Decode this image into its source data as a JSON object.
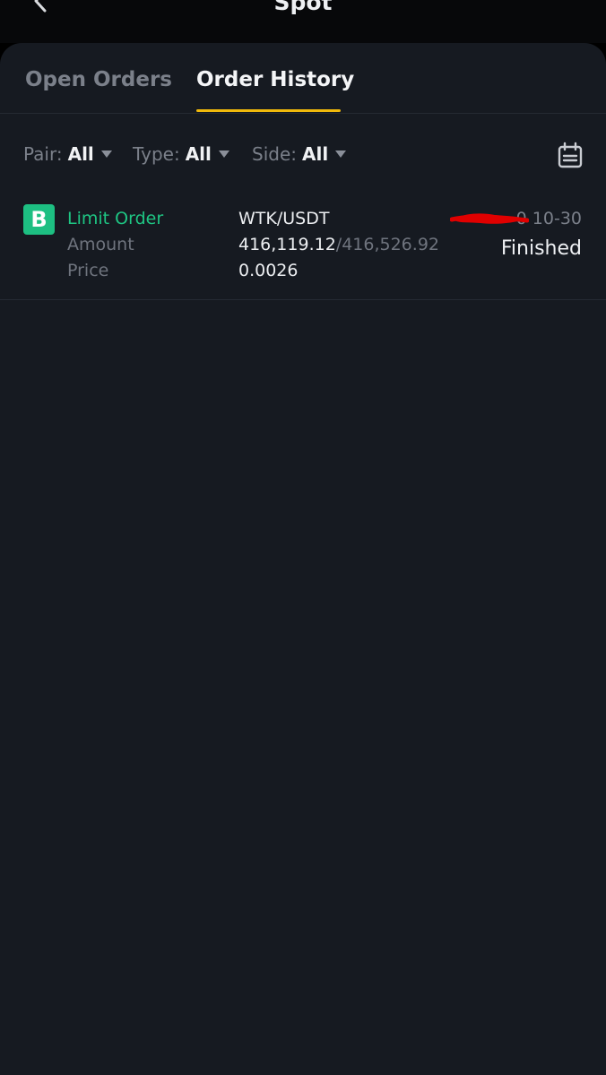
{
  "header": {
    "title": "Spot"
  },
  "tabs": [
    {
      "label": "Open Orders",
      "active": false
    },
    {
      "label": "Order History",
      "active": true
    }
  ],
  "filters": {
    "pair": {
      "label": "Pair:",
      "value": "All"
    },
    "type": {
      "label": "Type:",
      "value": "All"
    },
    "side": {
      "label": "Side:",
      "value": "All"
    }
  },
  "orders": [
    {
      "side_badge": "B",
      "order_type": "Limit Order",
      "amount_label": "Amount",
      "price_label": "Price",
      "pair": "WTK/USDT",
      "amount_filled": "416,119.12",
      "amount_separator": "/",
      "amount_total": "416,526.92",
      "price": "0.0026",
      "date_visible": "0 10-30",
      "status": "Finished"
    }
  ],
  "colors": {
    "accent": "#f0b90b",
    "buy": "#1dbf82",
    "background": "#161a21",
    "redaction": "#e00000"
  },
  "icons": [
    "back-arrow-icon",
    "calendar-icon",
    "caret-down-icon"
  ]
}
